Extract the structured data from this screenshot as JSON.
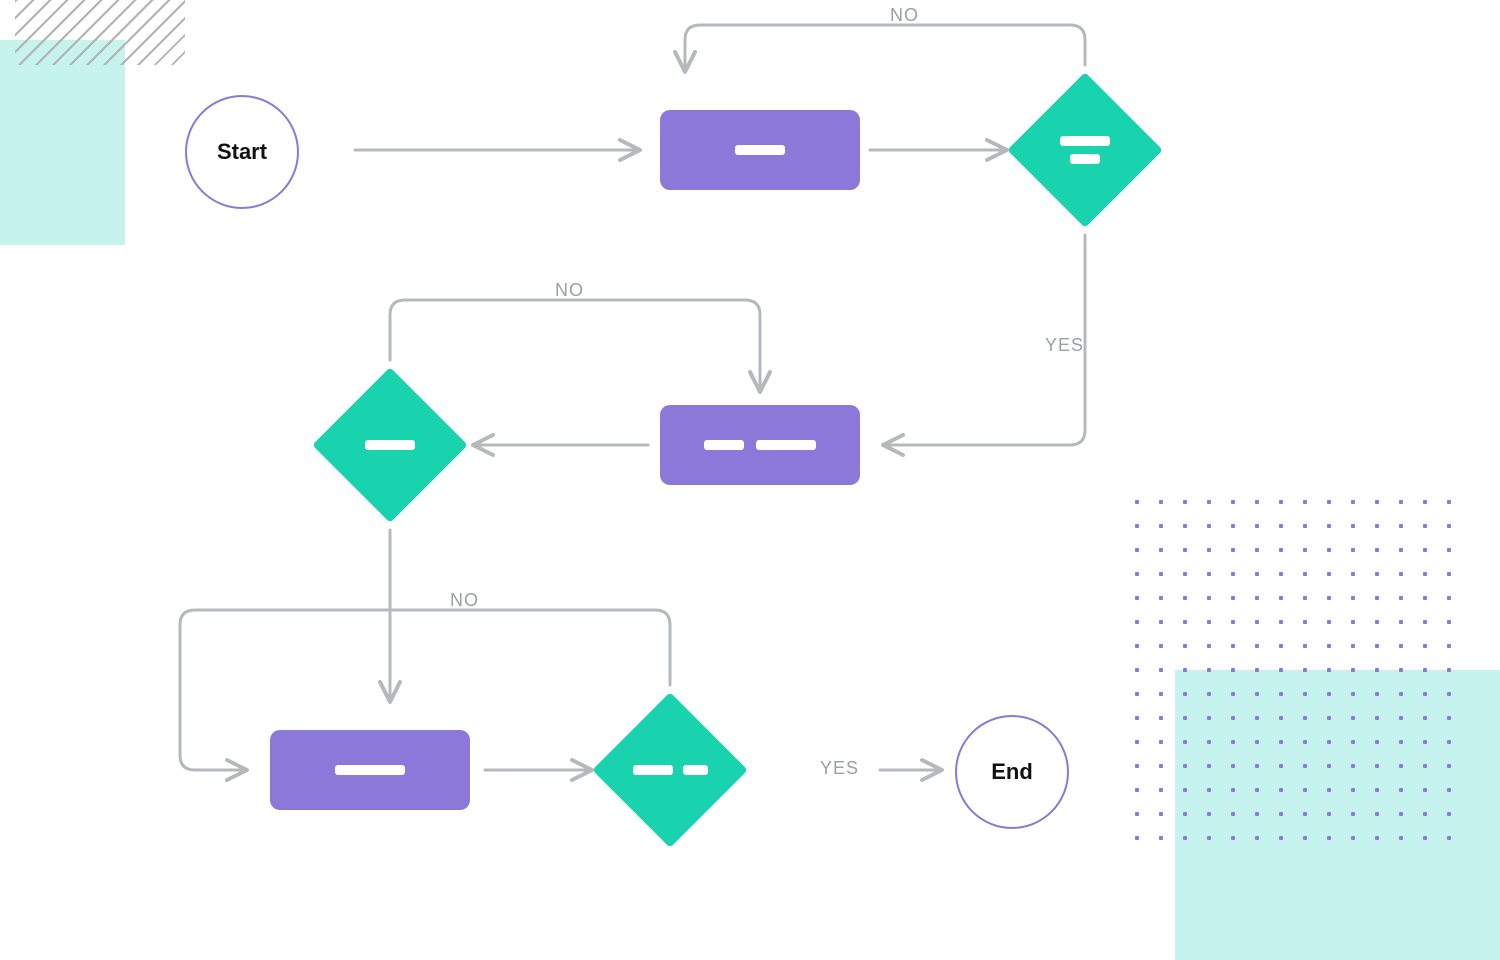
{
  "diagram": {
    "type": "flowchart",
    "nodes": {
      "start": {
        "kind": "terminator",
        "label": "Start"
      },
      "process1": {
        "kind": "process",
        "bars": [
          50
        ]
      },
      "decision1": {
        "kind": "decision",
        "bars": [
          50,
          30
        ]
      },
      "process2": {
        "kind": "process",
        "bars": [
          40,
          60
        ]
      },
      "decision2": {
        "kind": "decision",
        "bars": [
          50
        ]
      },
      "process3": {
        "kind": "process",
        "bars": [
          70
        ]
      },
      "decision3": {
        "kind": "decision",
        "bars": [
          40,
          25
        ]
      },
      "end": {
        "kind": "terminator",
        "label": "End"
      }
    },
    "edges": [
      {
        "from": "start",
        "to": "process1",
        "label": ""
      },
      {
        "from": "process1",
        "to": "decision1",
        "label": ""
      },
      {
        "from": "decision1",
        "to": "process1",
        "label": "NO"
      },
      {
        "from": "decision1",
        "to": "process2",
        "label": "YES"
      },
      {
        "from": "process2",
        "to": "decision2",
        "label": ""
      },
      {
        "from": "decision2",
        "to": "process2",
        "label": "NO"
      },
      {
        "from": "decision2",
        "to": "process3",
        "label": ""
      },
      {
        "from": "process3",
        "to": "decision3",
        "label": ""
      },
      {
        "from": "decision3",
        "to": "process3",
        "label": "NO"
      },
      {
        "from": "decision3",
        "to": "end",
        "label": "YES"
      }
    ],
    "labels": {
      "no1": "NO",
      "yes1": "YES",
      "no2": "NO",
      "no3": "NO",
      "yes3": "YES"
    },
    "colors": {
      "process": "#8b79d9",
      "decision": "#19d3ae",
      "terminatorBorder": "#8b79d9",
      "edge": "#b6b9bc",
      "mint": "#c6f3ed"
    }
  }
}
